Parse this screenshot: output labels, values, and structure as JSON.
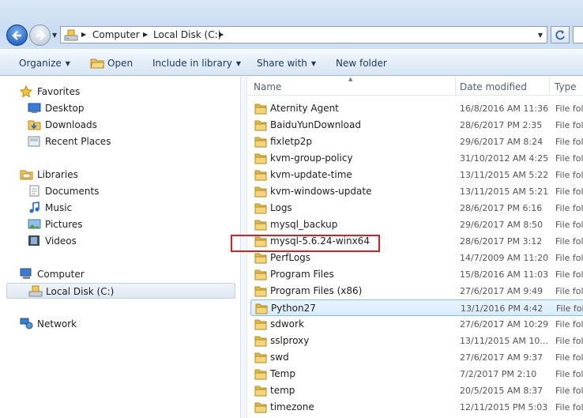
{
  "address": {
    "crumbs": [
      "Computer",
      "Local Disk (C:)"
    ]
  },
  "toolbar": {
    "organize": "Organize",
    "open": "Open",
    "include_in_library": "Include in library",
    "share_with": "Share with",
    "new_folder": "New folder"
  },
  "nav": {
    "favorites": "Favorites",
    "desktop": "Desktop",
    "downloads": "Downloads",
    "recent_places": "Recent Places",
    "libraries": "Libraries",
    "documents": "Documents",
    "music": "Music",
    "pictures": "Pictures",
    "videos": "Videos",
    "computer": "Computer",
    "local_disk": "Local Disk (C:)",
    "network": "Network"
  },
  "columns": {
    "name": "Name",
    "date_modified": "Date modified",
    "type": "Type"
  },
  "files": [
    {
      "name": "Aternity Agent",
      "date": "16/8/2016 AM 11:36",
      "type": "File fol"
    },
    {
      "name": "BaiduYunDownload",
      "date": "28/6/2017 PM 2:35",
      "type": "File fol"
    },
    {
      "name": "fixletp2p",
      "date": "29/6/2017 AM 8:24",
      "type": "File fol"
    },
    {
      "name": "kvm-group-policy",
      "date": "31/10/2012 AM 4:25",
      "type": "File fol"
    },
    {
      "name": "kvm-update-time",
      "date": "13/11/2015 AM 5:22",
      "type": "File fol"
    },
    {
      "name": "kvm-windows-update",
      "date": "13/11/2015 AM 5:21",
      "type": "File fol"
    },
    {
      "name": "Logs",
      "date": "28/6/2017 PM 6:16",
      "type": "File fol"
    },
    {
      "name": "mysql_backup",
      "date": "29/6/2017 AM 8:50",
      "type": "File fol"
    },
    {
      "name": "mysql-5.6.24-winx64",
      "date": "28/6/2017 PM 3:12",
      "type": "File fol"
    },
    {
      "name": "PerfLogs",
      "date": "14/7/2009 AM 11:20",
      "type": "File fol"
    },
    {
      "name": "Program Files",
      "date": "15/8/2016 AM 11:03",
      "type": "File fol"
    },
    {
      "name": "Program Files (x86)",
      "date": "27/6/2017 AM 9:49",
      "type": "File fol"
    },
    {
      "name": "Python27",
      "date": "13/1/2016 PM 4:42",
      "type": "File fol"
    },
    {
      "name": "sdwork",
      "date": "27/6/2017 AM 10:29",
      "type": "File fol"
    },
    {
      "name": "sslproxy",
      "date": "13/11/2015 AM 10...",
      "type": "File fol"
    },
    {
      "name": "swd",
      "date": "27/6/2017 AM 9:37",
      "type": "File fol"
    },
    {
      "name": "Temp",
      "date": "7/2/2017 PM 2:10",
      "type": "File fol"
    },
    {
      "name": "temp",
      "date": "20/5/2015 AM 8:37",
      "type": "File fol"
    },
    {
      "name": "timezone",
      "date": "12/11/2015 PM 5:03",
      "type": "File fol"
    }
  ],
  "colors": {
    "highlight_row": "#d8ebfb",
    "annotation_box": "#d0202a",
    "folder": "#f0c75a"
  }
}
